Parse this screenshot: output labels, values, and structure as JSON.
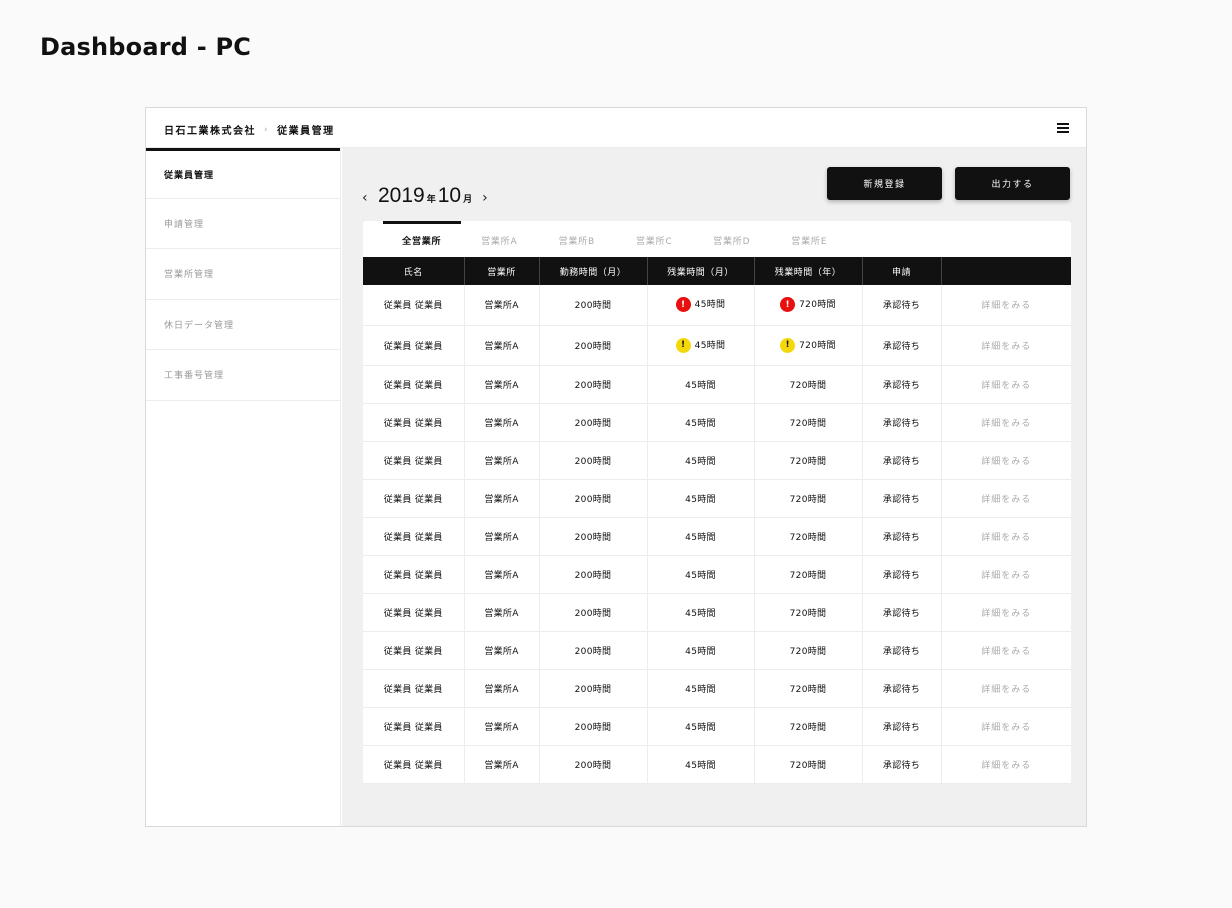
{
  "page": {
    "title": "Dashboard - PC"
  },
  "header": {
    "breadcrumb": [
      "日石工業株式会社",
      "従業員管理"
    ],
    "separator": "›"
  },
  "sidebar": {
    "items": [
      {
        "label": "従業員管理",
        "active": true
      },
      {
        "label": "申請管理",
        "active": false
      },
      {
        "label": "営業所管理",
        "active": false
      },
      {
        "label": "休日データ管理",
        "active": false
      },
      {
        "label": "工事番号管理",
        "active": false
      }
    ]
  },
  "date_nav": {
    "prev": "‹",
    "next": "›",
    "year": "2019",
    "year_unit": "年",
    "month": "10",
    "month_unit": "月"
  },
  "actions": {
    "new_label": "新規登録",
    "export_label": "出力する"
  },
  "tabs": [
    {
      "label": "全営業所",
      "active": true
    },
    {
      "label": "営業所A",
      "active": false
    },
    {
      "label": "営業所B",
      "active": false
    },
    {
      "label": "営業所C",
      "active": false
    },
    {
      "label": "営業所D",
      "active": false
    },
    {
      "label": "営業所E",
      "active": false
    }
  ],
  "table": {
    "columns": [
      "氏名",
      "営業所",
      "勤務時間（月）",
      "残業時間（月）",
      "残業時間（年）",
      "申請",
      ""
    ],
    "rows": [
      {
        "name": "従業員 従業員",
        "office": "営業所A",
        "work": "200時間",
        "ot_month": "45時間",
        "ot_year": "720時間",
        "status": "承認待ち",
        "action": "詳細をみる",
        "alert": "red"
      },
      {
        "name": "従業員 従業員",
        "office": "営業所A",
        "work": "200時間",
        "ot_month": "45時間",
        "ot_year": "720時間",
        "status": "承認待ち",
        "action": "詳細をみる",
        "alert": "yellow"
      },
      {
        "name": "従業員 従業員",
        "office": "営業所A",
        "work": "200時間",
        "ot_month": "45時間",
        "ot_year": "720時間",
        "status": "承認待ち",
        "action": "詳細をみる",
        "alert": ""
      },
      {
        "name": "従業員 従業員",
        "office": "営業所A",
        "work": "200時間",
        "ot_month": "45時間",
        "ot_year": "720時間",
        "status": "承認待ち",
        "action": "詳細をみる",
        "alert": ""
      },
      {
        "name": "従業員 従業員",
        "office": "営業所A",
        "work": "200時間",
        "ot_month": "45時間",
        "ot_year": "720時間",
        "status": "承認待ち",
        "action": "詳細をみる",
        "alert": ""
      },
      {
        "name": "従業員 従業員",
        "office": "営業所A",
        "work": "200時間",
        "ot_month": "45時間",
        "ot_year": "720時間",
        "status": "承認待ち",
        "action": "詳細をみる",
        "alert": ""
      },
      {
        "name": "従業員 従業員",
        "office": "営業所A",
        "work": "200時間",
        "ot_month": "45時間",
        "ot_year": "720時間",
        "status": "承認待ち",
        "action": "詳細をみる",
        "alert": ""
      },
      {
        "name": "従業員 従業員",
        "office": "営業所A",
        "work": "200時間",
        "ot_month": "45時間",
        "ot_year": "720時間",
        "status": "承認待ち",
        "action": "詳細をみる",
        "alert": ""
      },
      {
        "name": "従業員 従業員",
        "office": "営業所A",
        "work": "200時間",
        "ot_month": "45時間",
        "ot_year": "720時間",
        "status": "承認待ち",
        "action": "詳細をみる",
        "alert": ""
      },
      {
        "name": "従業員 従業員",
        "office": "営業所A",
        "work": "200時間",
        "ot_month": "45時間",
        "ot_year": "720時間",
        "status": "承認待ち",
        "action": "詳細をみる",
        "alert": ""
      },
      {
        "name": "従業員 従業員",
        "office": "営業所A",
        "work": "200時間",
        "ot_month": "45時間",
        "ot_year": "720時間",
        "status": "承認待ち",
        "action": "詳細をみる",
        "alert": ""
      },
      {
        "name": "従業員 従業員",
        "office": "営業所A",
        "work": "200時間",
        "ot_month": "45時間",
        "ot_year": "720時間",
        "status": "承認待ち",
        "action": "詳細をみる",
        "alert": ""
      },
      {
        "name": "従業員 従業員",
        "office": "営業所A",
        "work": "200時間",
        "ot_month": "45時間",
        "ot_year": "720時間",
        "status": "承認待ち",
        "action": "詳細をみる",
        "alert": ""
      }
    ]
  },
  "alert_icon_glyph": "!",
  "colors": {
    "alert_red": "#e80f0f",
    "alert_yellow": "#f5d80c",
    "dark": "#111111",
    "muted": "#aaaaaa"
  }
}
